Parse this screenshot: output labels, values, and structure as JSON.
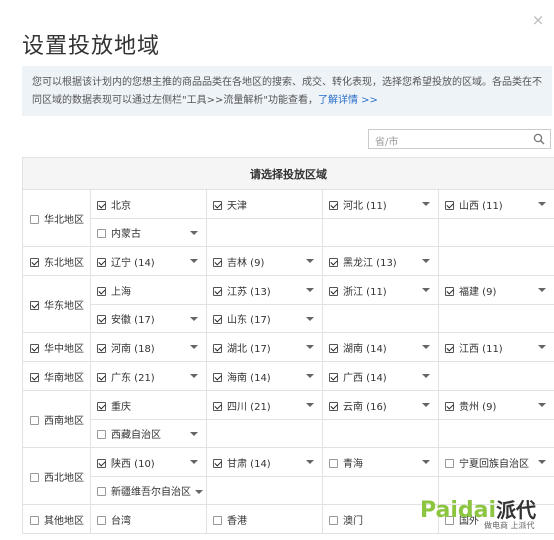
{
  "dialog": {
    "title": "设置投放地域",
    "close_glyph": "×",
    "info_text": "您可以根据该计划内的您想主推的商品品类在各地区的搜索、成交、转化表现，选择您希望投放的区域。各品类在不同区域的数据表现可以通过左侧栏\"工具>>流量解析\"功能查看，",
    "info_link": "了解详情 >>"
  },
  "search": {
    "placeholder": "省/市"
  },
  "table": {
    "header": "请选择投放区域",
    "regions": [
      {
        "name": "华北地区",
        "checked": false,
        "rows": [
          [
            {
              "label": "北京",
              "checked": true,
              "dropdown": false
            },
            {
              "label": "天津",
              "checked": true,
              "dropdown": false
            },
            {
              "label": "河北 (11)",
              "checked": true,
              "dropdown": true
            },
            {
              "label": "山西 (11)",
              "checked": true,
              "dropdown": true
            }
          ],
          [
            {
              "label": "内蒙古",
              "checked": false,
              "dropdown": true
            }
          ]
        ]
      },
      {
        "name": "东北地区",
        "checked": true,
        "rows": [
          [
            {
              "label": "辽宁 (14)",
              "checked": true,
              "dropdown": true
            },
            {
              "label": "吉林 (9)",
              "checked": true,
              "dropdown": true
            },
            {
              "label": "黑龙江 (13)",
              "checked": true,
              "dropdown": true
            }
          ]
        ]
      },
      {
        "name": "华东地区",
        "checked": true,
        "rows": [
          [
            {
              "label": "上海",
              "checked": true,
              "dropdown": false
            },
            {
              "label": "江苏 (13)",
              "checked": true,
              "dropdown": true
            },
            {
              "label": "浙江 (11)",
              "checked": true,
              "dropdown": true
            },
            {
              "label": "福建 (9)",
              "checked": true,
              "dropdown": true
            }
          ],
          [
            {
              "label": "安徽 (17)",
              "checked": true,
              "dropdown": true
            },
            {
              "label": "山东 (17)",
              "checked": true,
              "dropdown": true
            }
          ]
        ]
      },
      {
        "name": "华中地区",
        "checked": true,
        "rows": [
          [
            {
              "label": "河南 (18)",
              "checked": true,
              "dropdown": true
            },
            {
              "label": "湖北 (17)",
              "checked": true,
              "dropdown": true
            },
            {
              "label": "湖南 (14)",
              "checked": true,
              "dropdown": true
            },
            {
              "label": "江西 (11)",
              "checked": true,
              "dropdown": true
            }
          ]
        ]
      },
      {
        "name": "华南地区",
        "checked": true,
        "rows": [
          [
            {
              "label": "广东 (21)",
              "checked": true,
              "dropdown": true
            },
            {
              "label": "海南 (14)",
              "checked": true,
              "dropdown": true
            },
            {
              "label": "广西 (14)",
              "checked": true,
              "dropdown": true
            }
          ]
        ]
      },
      {
        "name": "西南地区",
        "checked": false,
        "rows": [
          [
            {
              "label": "重庆",
              "checked": true,
              "dropdown": false
            },
            {
              "label": "四川 (21)",
              "checked": true,
              "dropdown": true
            },
            {
              "label": "云南 (16)",
              "checked": true,
              "dropdown": true
            },
            {
              "label": "贵州 (9)",
              "checked": true,
              "dropdown": true
            }
          ],
          [
            {
              "label": "西藏自治区",
              "checked": false,
              "dropdown": true
            }
          ]
        ]
      },
      {
        "name": "西北地区",
        "checked": false,
        "rows": [
          [
            {
              "label": "陕西 (10)",
              "checked": true,
              "dropdown": true
            },
            {
              "label": "甘肃 (14)",
              "checked": true,
              "dropdown": true
            },
            {
              "label": "青海",
              "checked": false,
              "dropdown": true
            },
            {
              "label": "宁夏回族自治区",
              "checked": false,
              "dropdown": true
            }
          ],
          [
            {
              "label": "新疆维吾尔自治区",
              "checked": false,
              "dropdown": true,
              "inline_caret": true
            }
          ]
        ]
      },
      {
        "name": "其他地区",
        "checked": false,
        "rows": [
          [
            {
              "label": "台湾",
              "checked": false,
              "dropdown": false
            },
            {
              "label": "香港",
              "checked": false,
              "dropdown": false
            },
            {
              "label": "澳门",
              "checked": false,
              "dropdown": false
            },
            {
              "label": "国外",
              "checked": false,
              "dropdown": false
            }
          ]
        ]
      }
    ]
  },
  "watermark": {
    "brand": "Paidai",
    "brand_cn": "派代",
    "tagline": "做电商 上派代"
  }
}
